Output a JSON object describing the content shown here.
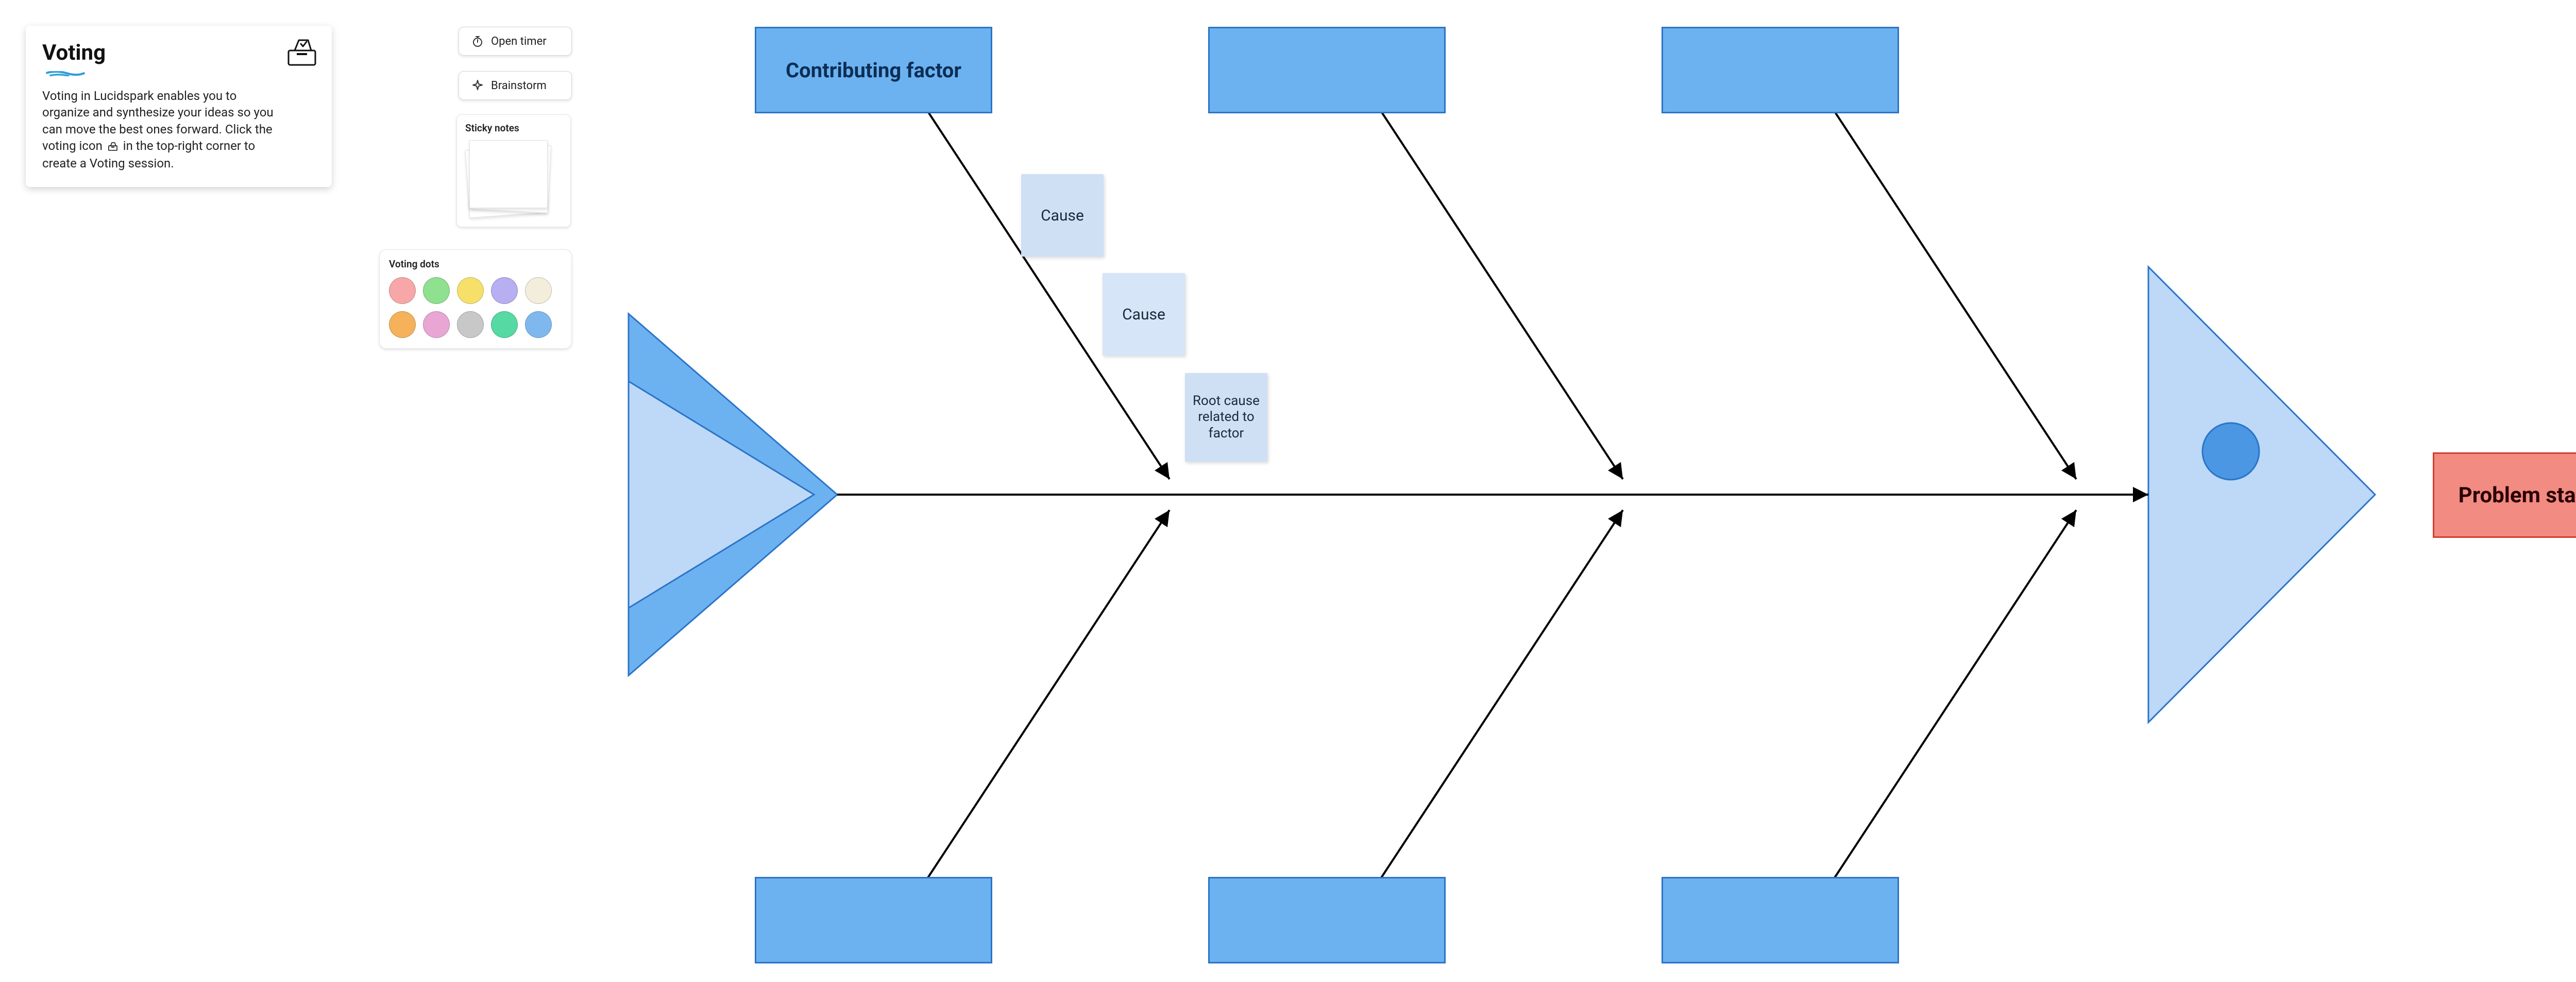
{
  "voting_card": {
    "title": "Voting",
    "body_before_icon": "Voting in Lucidspark enables you to organize and synthesize your ideas so you can move the best ones forward. Click the voting icon ",
    "body_after_icon": " in the top-right corner to create a Voting session."
  },
  "toolbar": {
    "open_timer": "Open timer",
    "brainstorm": "Brainstorm"
  },
  "sticky_panel": {
    "label": "Sticky notes"
  },
  "dots_panel": {
    "label": "Voting dots"
  },
  "dot_colors": [
    "#f7a7a7",
    "#8fe08f",
    "#f6e06a",
    "#b8aef2",
    "#f3eedb",
    "#f5b25a",
    "#e9a6d4",
    "#c8c8c8",
    "#57d9a3",
    "#7fb8ef"
  ],
  "fishbone": {
    "factors_top": [
      "Contributing factor",
      "",
      ""
    ],
    "factors_bottom": [
      "",
      "",
      ""
    ],
    "causes": {
      "c1": "Cause",
      "c2": "Cause",
      "c3": "Root cause related to factor"
    },
    "problem": "Problem statement"
  }
}
